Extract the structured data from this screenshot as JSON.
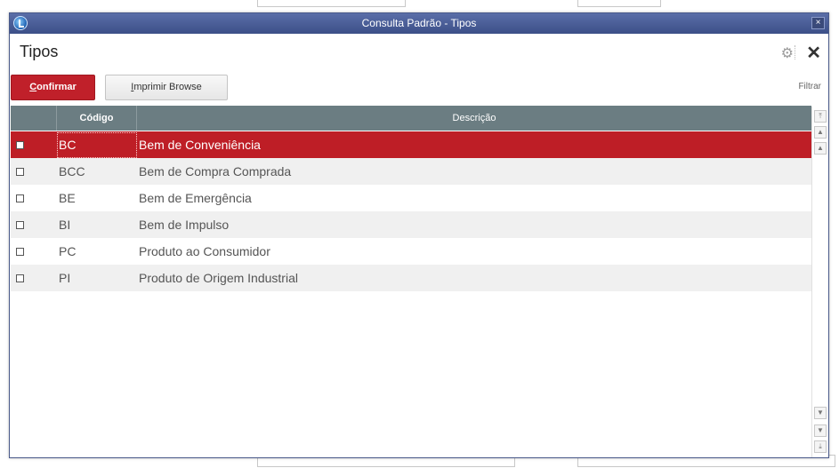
{
  "window": {
    "title": "Consulta Padrão - Tipos",
    "close_glyph": "×"
  },
  "header": {
    "title": "Tipos",
    "gear_glyph": "⚙",
    "close_glyph": "✕"
  },
  "toolbar": {
    "confirm_first": "C",
    "confirm_rest": "onfirmar",
    "print_first": "I",
    "print_rest": "mprimir Browse",
    "filter_label": "Filtrar"
  },
  "grid": {
    "columns": [
      "Código",
      "Descrição"
    ],
    "rows": [
      {
        "code": "BC",
        "description": "Bem de Conveniência",
        "selected": true
      },
      {
        "code": "BCC",
        "description": "Bem de Compra Comprada",
        "selected": false
      },
      {
        "code": "BE",
        "description": "Bem de Emergência",
        "selected": false
      },
      {
        "code": "BI",
        "description": "Bem de Impulso",
        "selected": false
      },
      {
        "code": "PC",
        "description": "Produto ao Consumidor",
        "selected": false
      },
      {
        "code": "PI",
        "description": "Produto de Origem Industrial",
        "selected": false
      }
    ]
  },
  "colors": {
    "accent": "#c0202a",
    "header": "#6b7d82",
    "titlebar": "#3c4f88"
  },
  "icons": [
    "app-logo-icon",
    "gear-icon",
    "close-icon",
    "scroll-top-icon",
    "scroll-up-icon",
    "scroll-down-icon",
    "scroll-bottom-icon"
  ]
}
